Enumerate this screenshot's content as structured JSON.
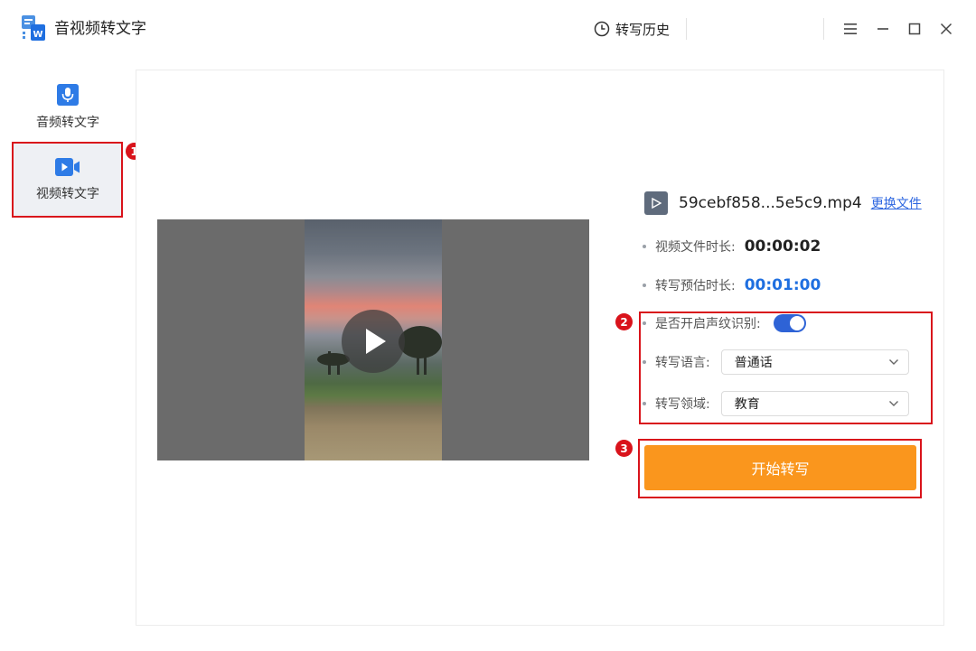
{
  "app": {
    "title": "音视频转文字",
    "logo_icon": "app-logo-icon"
  },
  "header": {
    "history_label": "转写历史",
    "history_icon": "clock-icon"
  },
  "window_controls": [
    "menu-icon",
    "minimize-icon",
    "maximize-icon",
    "close-icon"
  ],
  "sidebar": {
    "items": [
      {
        "label": "音频转文字",
        "icon": "microphone-icon",
        "active": false
      },
      {
        "label": "视频转文字",
        "icon": "video-camera-icon",
        "active": true
      }
    ]
  },
  "annotations": {
    "badges": [
      "1",
      "2",
      "3"
    ],
    "color": "#d9131b"
  },
  "file": {
    "name": "59cebf858...5e5c9.mp4",
    "change_label": "更换文件",
    "icon": "video-file-icon"
  },
  "info": {
    "duration_label": "视频文件时长:",
    "duration_value": "00:00:02",
    "estimate_label": "转写预估时长:",
    "estimate_value": "00:01:00"
  },
  "settings": {
    "voiceprint_label": "是否开启声纹识别:",
    "voiceprint_on": true,
    "language_label": "转写语言:",
    "language_value": "普通话",
    "domain_label": "转写领域:",
    "domain_value": "教育"
  },
  "start_button": {
    "label": "开始转写"
  },
  "colors": {
    "accent_blue": "#2e63d6",
    "start_orange": "#fa961d",
    "link_blue": "#2e67e0",
    "estimate_blue": "#1f6fe0"
  }
}
